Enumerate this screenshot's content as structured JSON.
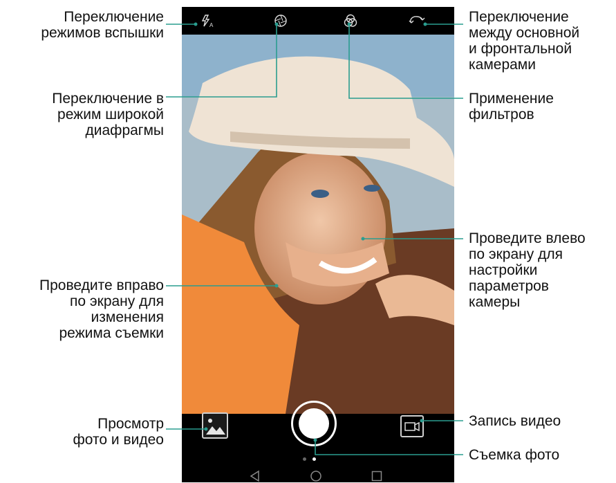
{
  "callouts": {
    "flash": [
      "Переключение",
      "режимов вспышки"
    ],
    "aperture": [
      "Переключение в",
      "режим широкой",
      "диафрагмы"
    ],
    "swipe_right": [
      "Проведите вправо",
      "по экрану для",
      "изменения",
      "режима съемки"
    ],
    "gallery": [
      "Просмотр",
      "фото и видео"
    ],
    "switch_camera": [
      "Переключение",
      "между основной",
      "и фронтальной",
      "камерами"
    ],
    "filters": [
      "Применение",
      "фильтров"
    ],
    "swipe_left": [
      "Проведите влево",
      "по экрану для",
      "настройки",
      "параметров",
      "камеры"
    ],
    "video": [
      "Запись видео"
    ],
    "shutter": [
      "Съемка фото"
    ]
  },
  "icons": {
    "flash": "flash-auto-icon",
    "aperture": "aperture-icon",
    "filters": "filters-icon",
    "switch_camera": "switch-camera-icon",
    "gallery": "gallery-thumbnail-icon",
    "video": "video-record-icon",
    "back": "back-triangle-icon",
    "home": "home-circle-icon",
    "recents": "recents-square-icon"
  },
  "colors": {
    "leader_line": "#2a9d8f",
    "background": "#ffffff",
    "ui_bar": "#000000"
  }
}
